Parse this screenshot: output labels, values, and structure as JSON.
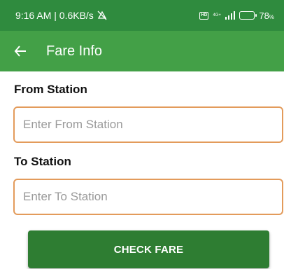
{
  "status_bar": {
    "time_speed": "9:16 AM | 0.6KB/s",
    "mute_icon": "silent-icon",
    "network_label": "4G+",
    "battery_label": "78",
    "battery_level_percent": 78
  },
  "app_bar": {
    "back_icon": "arrow-left-icon",
    "title": "Fare Info"
  },
  "form": {
    "from_label": "From Station",
    "from_placeholder": "Enter From Station",
    "from_value": "",
    "to_label": "To Station",
    "to_placeholder": "Enter To Station",
    "to_value": ""
  },
  "actions": {
    "check_fare_label": "CHECK FARE"
  },
  "colors": {
    "status_bar": "#2f8b3e",
    "app_bar": "#43a047",
    "input_border": "#e39b5b",
    "button": "#2e7d32"
  }
}
